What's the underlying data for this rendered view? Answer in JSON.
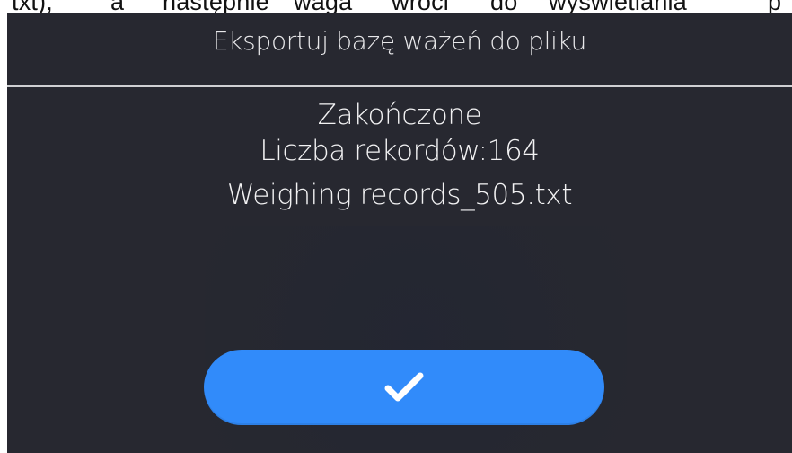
{
  "document_fragment": {
    "parts": [
      "txt),",
      "a",
      "następnie",
      "waga",
      "wróci",
      "do",
      "wyświetlania",
      "p"
    ]
  },
  "dialog": {
    "title": "Eksportuj bazę ważeń do pliku",
    "status": "Zakończone",
    "record_count": "Liczba rekordów:164",
    "file_name": "Weighing records_505.txt"
  },
  "buttons": {
    "confirm": {
      "icon": "check-icon",
      "color": "#318bfa"
    }
  },
  "colors": {
    "screen_background": "#272830",
    "text": "#f2f2f3",
    "divider": "#cfd0d3"
  }
}
